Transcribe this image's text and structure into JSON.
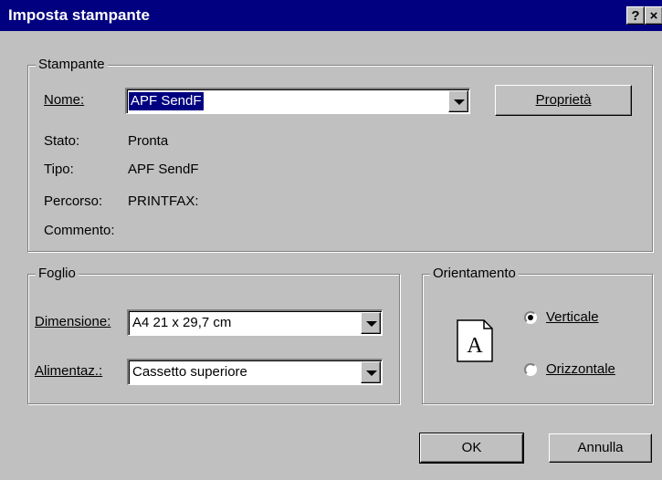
{
  "window": {
    "title": "Imposta stampante",
    "help_glyph": "?",
    "close_glyph": "×"
  },
  "printer": {
    "group_label": "Stampante",
    "name_label": "Nome:",
    "name_value": "APF SendF",
    "properties_button": "Proprietà",
    "status_label": "Stato:",
    "status_value": "Pronta",
    "type_label": "Tipo:",
    "type_value": "APF SendF",
    "path_label": "Percorso:",
    "path_value": "PRINTFAX:",
    "comment_label": "Commento:",
    "comment_value": ""
  },
  "paper": {
    "group_label": "Foglio",
    "size_label": "Dimensione:",
    "size_value": "A4 21 x 29,7 cm",
    "source_label": "Alimentaz.:",
    "source_value": "Cassetto superiore"
  },
  "orientation": {
    "group_label": "Orientamento",
    "preview_letter": "A",
    "portrait_label": "Verticale",
    "landscape_label": "Orizzontale",
    "selected": "Verticale"
  },
  "buttons": {
    "ok": "OK",
    "cancel": "Annulla"
  }
}
